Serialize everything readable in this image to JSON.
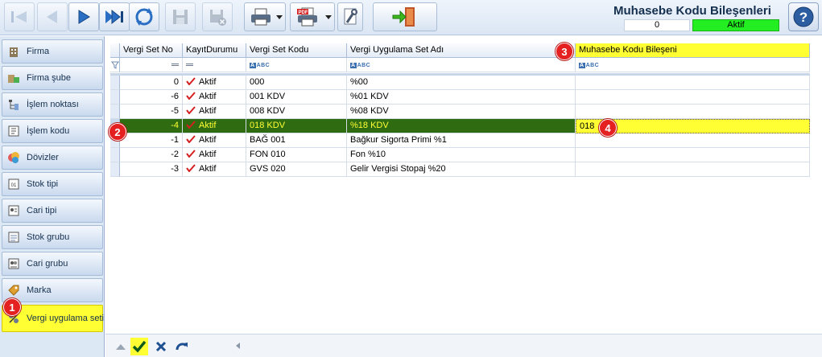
{
  "header": {
    "title": "Muhasebe Kodu Bileşenleri",
    "record_count": "0",
    "status": "Aktif",
    "status_color": "#22ee22"
  },
  "toolbar": {
    "buttons": [
      "first-icon",
      "prev-icon",
      "next-icon",
      "last-icon",
      "refresh-icon",
      "save-icon",
      "delete-icon",
      "print-icon",
      "pdf-icon",
      "settings-icon",
      "exit-icon",
      "help-icon"
    ]
  },
  "sidebar": {
    "items": [
      {
        "label": "Firma",
        "icon": "building-icon"
      },
      {
        "label": "Firma şube",
        "icon": "branch-icon"
      },
      {
        "label": "İşlem noktası",
        "icon": "tree-icon"
      },
      {
        "label": "İşlem kodu",
        "icon": "code-icon"
      },
      {
        "label": "Dövizler",
        "icon": "currency-icon"
      },
      {
        "label": "Stok tipi",
        "icon": "stock-type-icon"
      },
      {
        "label": "Cari tipi",
        "icon": "account-type-icon"
      },
      {
        "label": "Stok grubu",
        "icon": "stock-group-icon"
      },
      {
        "label": "Cari grubu",
        "icon": "account-group-icon"
      },
      {
        "label": "Marka",
        "icon": "tag-icon"
      },
      {
        "label": "Vergi uygulama seti",
        "icon": "tax-set-icon"
      }
    ],
    "active_index": 10,
    "active_color": "#ffff33"
  },
  "grid": {
    "columns": [
      "Vergi Set No",
      "KayıtDurumu",
      "Vergi Set Kodu",
      "Vergi Uygulama Set Adı",
      "Muhasebe Kodu Bileşeni"
    ],
    "filter_text_marker": "ABC",
    "rows": [
      {
        "no": "0",
        "status": "Aktif",
        "code": "000",
        "name": "%00",
        "component": ""
      },
      {
        "no": "-6",
        "status": "Aktif",
        "code": "001 KDV",
        "name": "%01 KDV",
        "component": ""
      },
      {
        "no": "-5",
        "status": "Aktif",
        "code": "008 KDV",
        "name": "%08 KDV",
        "component": ""
      },
      {
        "no": "-4",
        "status": "Aktif",
        "code": "018 KDV",
        "name": "%18 KDV",
        "component": "018"
      },
      {
        "no": "-1",
        "status": "Aktif",
        "code": "BAĞ 001",
        "name": "Bağkur Sigorta Primi %1",
        "component": ""
      },
      {
        "no": "-2",
        "status": "Aktif",
        "code": "FON 010",
        "name": "Fon %10",
        "component": ""
      },
      {
        "no": "-3",
        "status": "Aktif",
        "code": "GVS 020",
        "name": "Gelir Vergisi Stopaj %20",
        "component": ""
      }
    ],
    "selected_index": 3,
    "selected_color": "#2f6b10",
    "highlight_color": "#ffff33"
  },
  "badges": [
    "1",
    "2",
    "3",
    "4"
  ],
  "bottom_nav": {
    "buttons": [
      "up-icon",
      "confirm-icon",
      "cancel-icon",
      "redo-icon"
    ]
  }
}
